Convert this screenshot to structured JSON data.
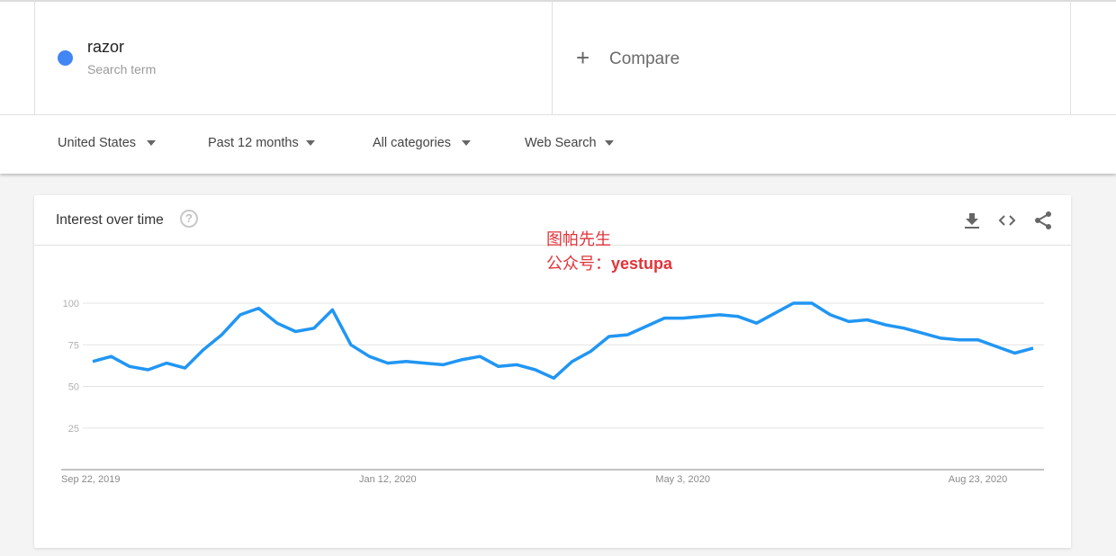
{
  "search_term": {
    "name": "razor",
    "subtitle": "Search term",
    "color": "#4285f4"
  },
  "compare": {
    "icon": "plus-icon",
    "label": "Compare"
  },
  "filters": [
    {
      "label": "United States",
      "icon": "caret-down-icon"
    },
    {
      "label": "Past 12 months",
      "icon": "caret-down-icon"
    },
    {
      "label": "All categories",
      "icon": "caret-down-icon"
    },
    {
      "label": "Web Search",
      "icon": "caret-down-icon"
    }
  ],
  "card": {
    "title": "Interest over time",
    "help_icon": "help-circle-icon",
    "help_glyph": "?",
    "actions": [
      {
        "name": "download-icon"
      },
      {
        "name": "embed-code-icon"
      },
      {
        "name": "share-icon"
      }
    ]
  },
  "watermark": {
    "line1": "图帕先生",
    "line2_prefix": "公众号：",
    "line2_bold": "yestupa"
  },
  "chart_data": {
    "type": "line",
    "title": "Interest over time",
    "xlabel": "",
    "ylabel": "",
    "ylim": [
      0,
      100
    ],
    "yticks": [
      25,
      50,
      75,
      100
    ],
    "xtick_labels": [
      "Sep 22, 2019",
      "Jan 12, 2020",
      "May 3, 2020",
      "Aug 23, 2020"
    ],
    "xtick_indices": [
      0,
      16,
      32,
      48
    ],
    "grid": true,
    "series": [
      {
        "name": "razor",
        "color": "#2196f3",
        "values": [
          65,
          68,
          62,
          60,
          64,
          61,
          72,
          81,
          93,
          97,
          88,
          83,
          85,
          96,
          75,
          68,
          64,
          65,
          64,
          63,
          66,
          68,
          62,
          63,
          60,
          55,
          65,
          71,
          80,
          81,
          86,
          91,
          91,
          92,
          93,
          92,
          88,
          94,
          100,
          100,
          93,
          89,
          90,
          87,
          85,
          82,
          79,
          78,
          78,
          74,
          70,
          73
        ]
      }
    ]
  }
}
